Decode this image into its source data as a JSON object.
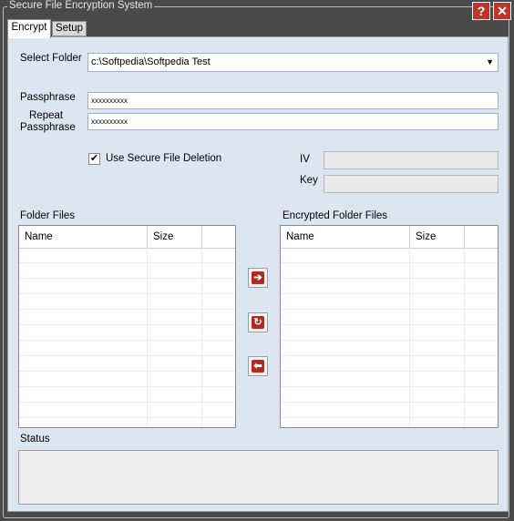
{
  "window": {
    "title": "Secure File Encryption System",
    "help_glyph": "?",
    "close_glyph": "✕"
  },
  "tabs": [
    {
      "label": "Encrypt"
    },
    {
      "label": "Setup"
    }
  ],
  "encrypt": {
    "select_folder_label": "Select Folder",
    "folder_value": "c:\\Softpedia\\Softpedia Test",
    "dropdown_icon": "chevron-down-icon",
    "passphrase_label": "Passphrase",
    "passphrase_value": "xxxxxxxxxx",
    "repeat_label_line1": "Repeat",
    "repeat_label_line2": "Passphrase",
    "repeat_value": "xxxxxxxxxx",
    "secure_delete_label": "Use Secure File Deletion",
    "secure_delete_checked": "✔",
    "iv_label": "IV",
    "iv_value": "",
    "key_label": "Key",
    "key_value": "",
    "folder_files_label": "Folder Files",
    "encrypted_files_label": "Encrypted Folder Files",
    "columns": {
      "name": "Name",
      "size": "Size"
    },
    "status_label": "Status",
    "status_value": ""
  },
  "actions": {
    "encrypt_glyph": "➔",
    "refresh_glyph": "↻",
    "decrypt_glyph": "⬅"
  },
  "colors": {
    "panel_bg": "#dde6f0",
    "accent_red": "#b22a22",
    "frame_bg": "#4a4a4a"
  }
}
